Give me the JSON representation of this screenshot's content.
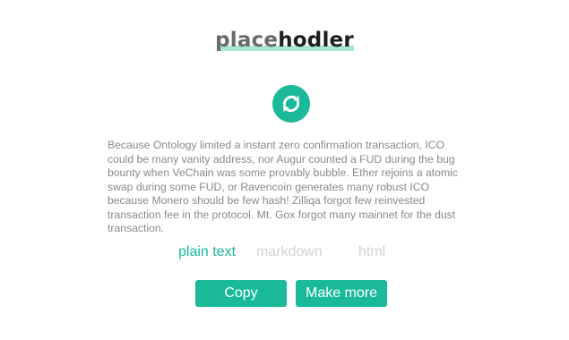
{
  "logo": {
    "part_a": "place",
    "part_b": "hodler",
    "underline_color": "#a8e6d6"
  },
  "refresh": {
    "icon": "refresh-icon",
    "color": "#19b99a"
  },
  "paragraph": {
    "text": "Because Ontology limited a instant zero confirmation transaction, ICO could be many vanity address, nor Augur counted a FUD during the bug bounty when VeChain was some provably bubble. Ether rejoins a atomic swap during some FUD, or Ravencoin generates many robust ICO because Monero should be few hash! Zilliqa forgot few reinvested transaction fee in the protocol. Mt. Gox forgot many mainnet for the dust transaction."
  },
  "tabs": [
    {
      "label": "plain text",
      "active": true
    },
    {
      "label": "markdown",
      "active": false
    },
    {
      "label": "html",
      "active": false
    }
  ],
  "buttons": {
    "copy": "Copy",
    "make_more": "Make more"
  },
  "colors": {
    "accent": "#19b99a",
    "text": "#8a8a8a",
    "inactive_tab": "#d2d2d2"
  }
}
